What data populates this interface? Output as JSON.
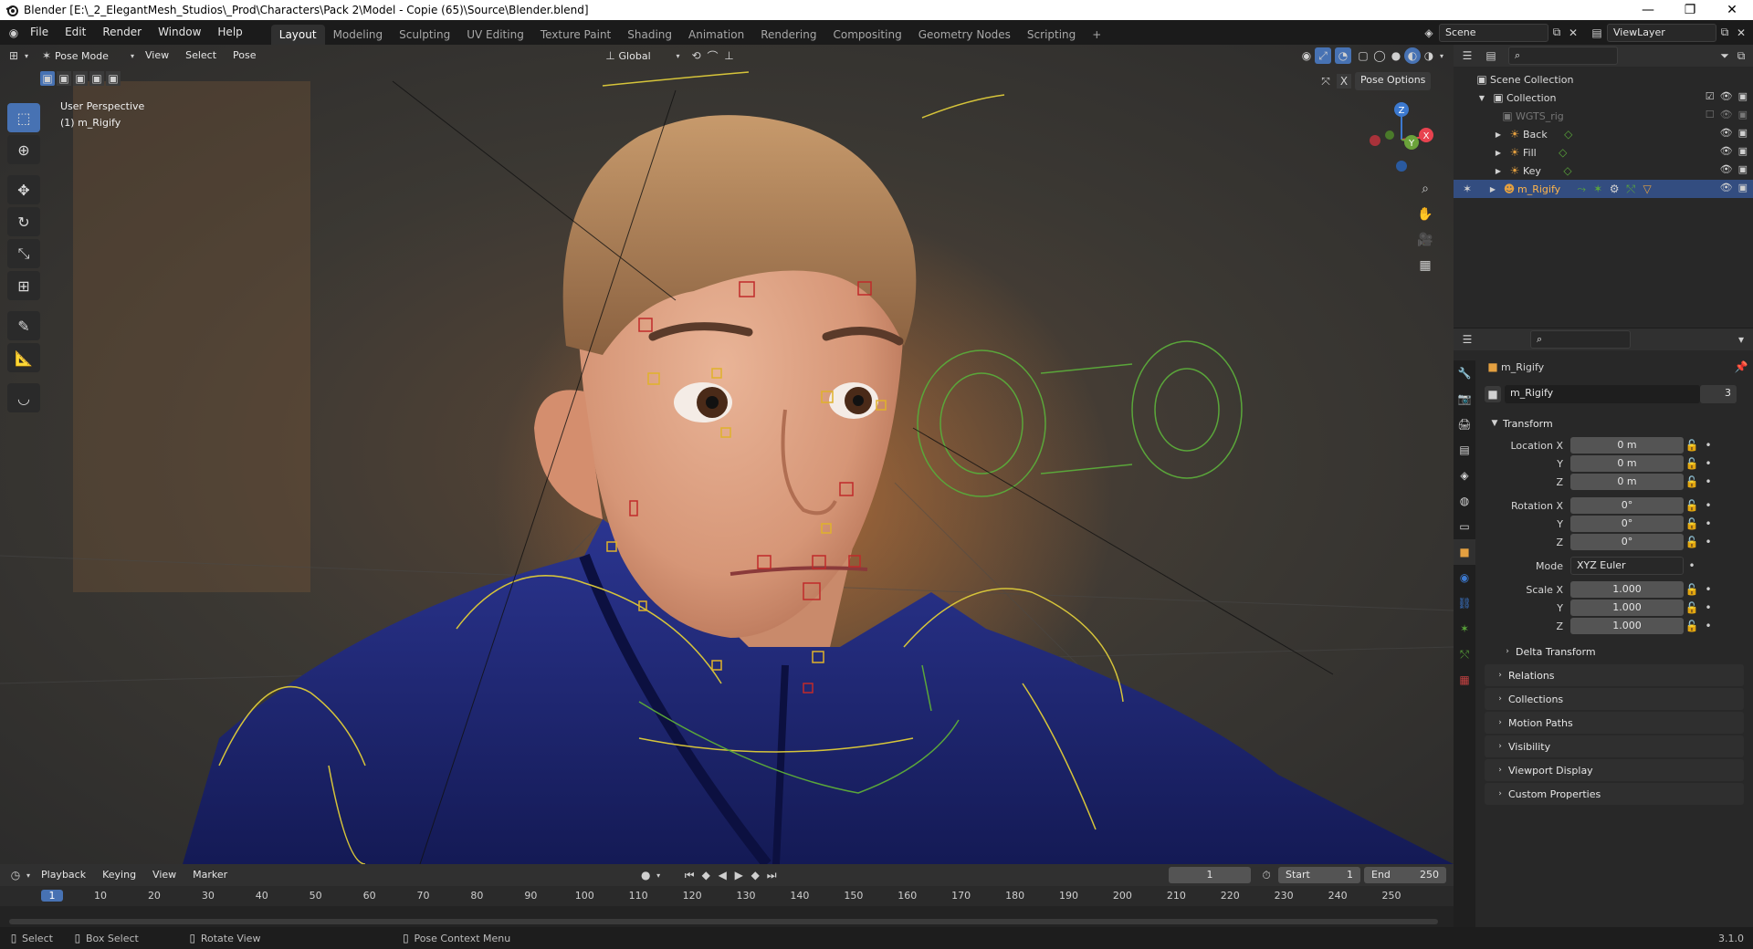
{
  "titlebar": {
    "title": "Blender [E:\\_2_ElegantMesh_Studios\\_Prod\\Characters\\Pack 2\\Model - Copie (65)\\Source\\Blender.blend]",
    "minimize": "—",
    "maximize": "❐",
    "close": "✕"
  },
  "menubar": {
    "items": [
      "File",
      "Edit",
      "Render",
      "Window",
      "Help"
    ],
    "workspaces": [
      "Layout",
      "Modeling",
      "Sculpting",
      "UV Editing",
      "Texture Paint",
      "Shading",
      "Animation",
      "Rendering",
      "Compositing",
      "Geometry Nodes",
      "Scripting"
    ],
    "active_workspace": "Layout",
    "add_tab": "+",
    "scene": "Scene",
    "view_layer": "ViewLayer"
  },
  "viewport_header": {
    "mode": "Pose Mode",
    "menus": [
      "View",
      "Select",
      "Pose"
    ],
    "orientation": "Global",
    "pose_options": "Pose Options"
  },
  "viewport": {
    "perspective": "User Perspective",
    "object_info": "(1) m_Rigify",
    "gizmo": {
      "z": "Z",
      "y": "Y",
      "x": "X"
    }
  },
  "outliner": {
    "search_placeholder": "",
    "scene_collection": "Scene Collection",
    "collection": "Collection",
    "items": [
      {
        "name": "WGTS_rig",
        "muted": true
      },
      {
        "name": "Back"
      },
      {
        "name": "Fill"
      },
      {
        "name": "Key"
      },
      {
        "name": "m_Rigify",
        "selected": true
      }
    ]
  },
  "properties": {
    "object_name": "m_Rigify",
    "datablock_name": "m_Rigify",
    "user_count": "3",
    "transform_label": "Transform",
    "location": {
      "label_x": "Location X",
      "label_y": "Y",
      "label_z": "Z",
      "x": "0 m",
      "y": "0 m",
      "z": "0 m"
    },
    "rotation": {
      "label_x": "Rotation X",
      "label_y": "Y",
      "label_z": "Z",
      "x": "0°",
      "y": "0°",
      "z": "0°"
    },
    "mode_label": "Mode",
    "mode_value": "XYZ Euler",
    "scale": {
      "label_x": "Scale X",
      "label_y": "Y",
      "label_z": "Z",
      "x": "1.000",
      "y": "1.000",
      "z": "1.000"
    },
    "delta_transform": "Delta Transform",
    "sections": [
      "Relations",
      "Collections",
      "Motion Paths",
      "Visibility",
      "Viewport Display",
      "Custom Properties"
    ]
  },
  "timeline": {
    "menus": [
      "Playback",
      "Keying",
      "View",
      "Marker"
    ],
    "current_frame": "1",
    "start_label": "Start",
    "start": "1",
    "end_label": "End",
    "end": "250",
    "ticks": [
      "1",
      "10",
      "20",
      "30",
      "40",
      "50",
      "60",
      "70",
      "80",
      "90",
      "100",
      "110",
      "120",
      "130",
      "140",
      "150",
      "160",
      "170",
      "180",
      "190",
      "200",
      "210",
      "220",
      "230",
      "240",
      "250"
    ]
  },
  "statusbar": {
    "select": "Select",
    "box_select": "Box Select",
    "rotate_view": "Rotate View",
    "context_menu": "Pose Context Menu",
    "version": "3.1.0"
  },
  "colors": {
    "accent": "#4772b3",
    "selected_row": "#334d80",
    "gizmo_x": "#e8424f",
    "gizmo_y": "#6ba33a",
    "gizmo_z": "#3c79cf",
    "armature_yellow": "#d6c43a",
    "armature_green": "#5aa63a"
  }
}
